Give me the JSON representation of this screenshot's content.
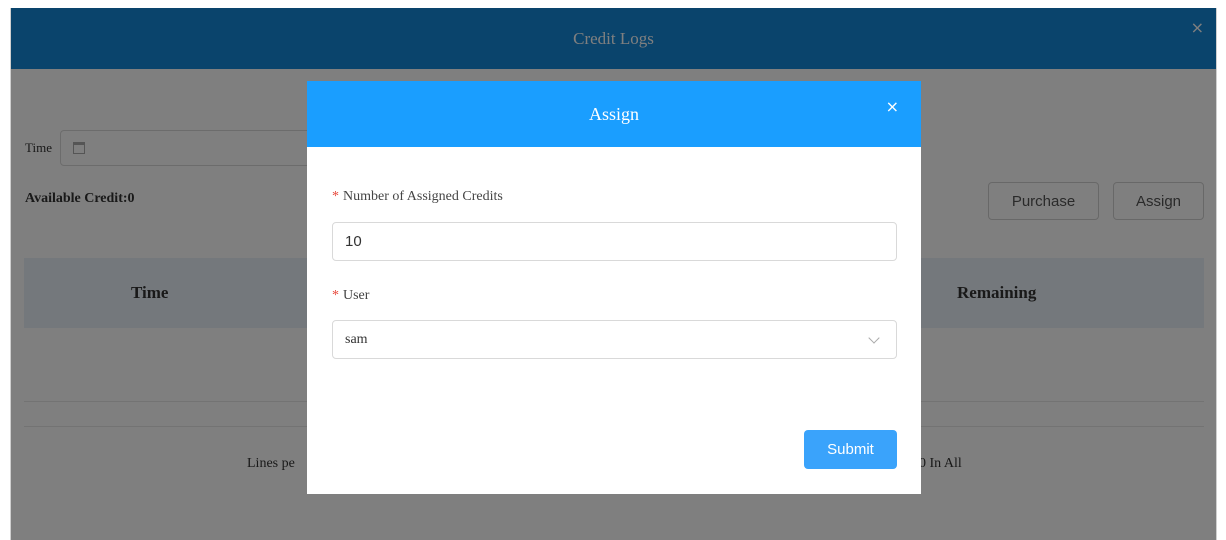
{
  "window": {
    "title": "Credit Logs",
    "close_glyph": "×"
  },
  "filter": {
    "time_label": "Time"
  },
  "credit": {
    "available_label": "Available Credit:0"
  },
  "actions": {
    "purchase_label": "Purchase",
    "assign_label": "Assign"
  },
  "table": {
    "columns": [
      "Time",
      "Remaining"
    ]
  },
  "pagination": {
    "lines_label": "Lines pe",
    "total_label": "0 In All"
  },
  "modal": {
    "title": "Assign",
    "close_glyph": "×",
    "credits_field": {
      "required_mark": "*",
      "label": "Number of Assigned Credits",
      "value": "10"
    },
    "user_field": {
      "required_mark": "*",
      "label": "User",
      "selected": "sam"
    },
    "submit_label": "Submit"
  },
  "colors": {
    "header_bg": "#1488d8",
    "modal_header_bg": "#1a9eff",
    "submit_bg": "#3aa3fb",
    "required": "#e8483b"
  }
}
